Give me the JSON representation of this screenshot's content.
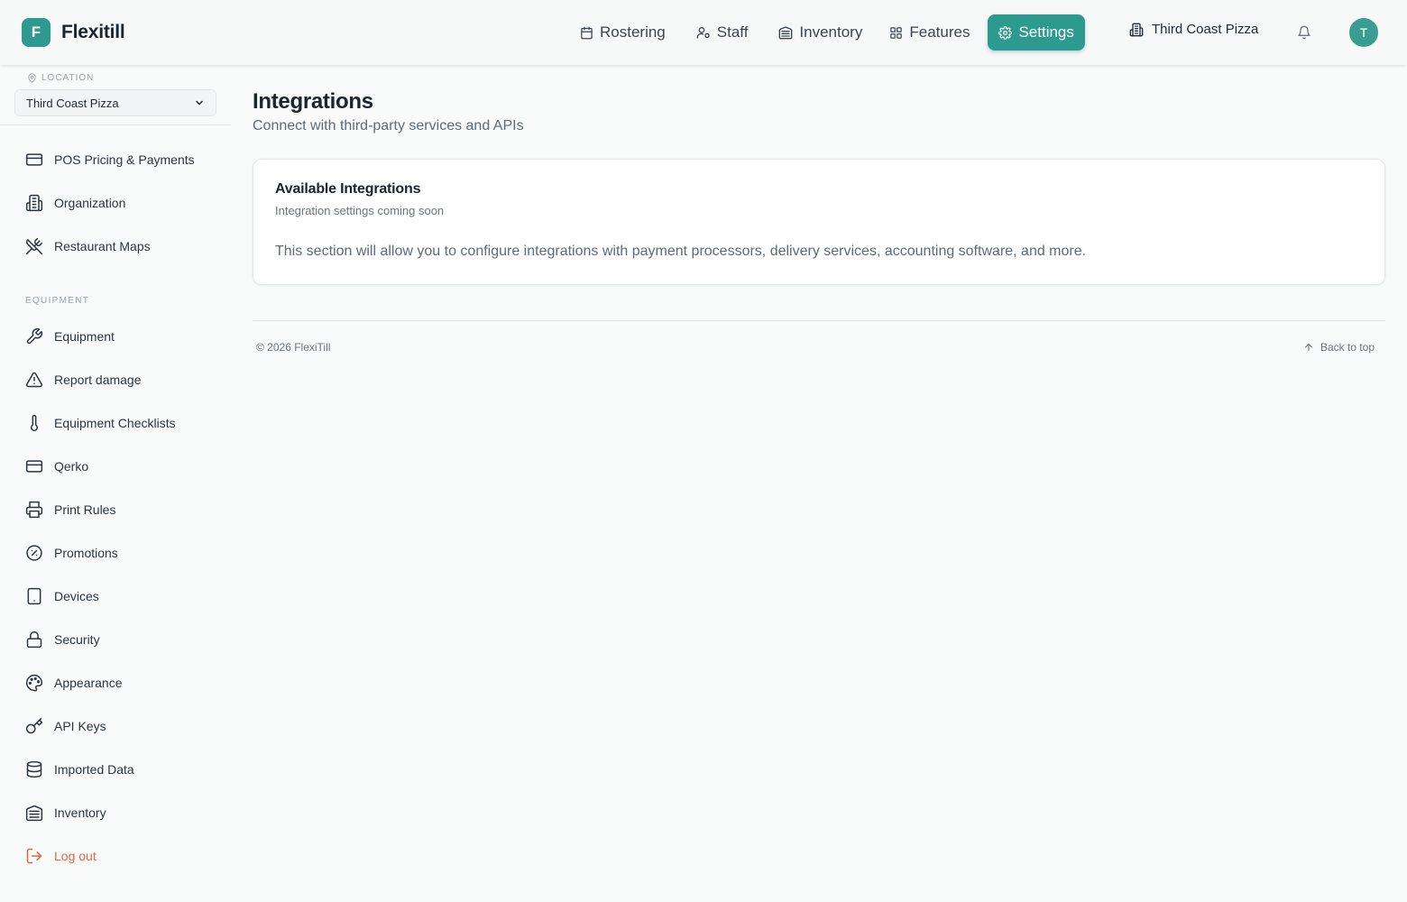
{
  "app": {
    "name": "Flexitill",
    "logo_letter": "F"
  },
  "nav": {
    "items": [
      {
        "label": "Rostering",
        "icon": "calendar-icon"
      },
      {
        "label": "Staff",
        "icon": "users-icon"
      },
      {
        "label": "Inventory",
        "icon": "warehouse-icon"
      },
      {
        "label": "Features",
        "icon": "grid-icon"
      },
      {
        "label": "Settings",
        "icon": "gear-icon",
        "active": true
      }
    ],
    "venue": "Third Coast Pizza",
    "avatar_initial": "T"
  },
  "sidebar": {
    "location_label": "Location",
    "location_value": "Third Coast Pizza",
    "items_top": [
      {
        "label": "POS Pricing & Payments",
        "icon": "credit-card-icon"
      },
      {
        "label": "Organization",
        "icon": "building-icon"
      },
      {
        "label": "Restaurant Maps",
        "icon": "utensils-crossed-icon"
      }
    ],
    "section_label": "Equipment",
    "items_equipment": [
      {
        "label": "Equipment",
        "icon": "wrench-icon"
      },
      {
        "label": "Report damage",
        "icon": "warning-icon"
      },
      {
        "label": "Equipment Checklists",
        "icon": "thermometer-icon"
      },
      {
        "label": "Qerko",
        "icon": "credit-card-icon"
      },
      {
        "label": "Print Rules",
        "icon": "printer-icon"
      },
      {
        "label": "Promotions",
        "icon": "badge-percent-icon"
      },
      {
        "label": "Devices",
        "icon": "tablet-icon"
      },
      {
        "label": "Security",
        "icon": "lock-icon"
      },
      {
        "label": "Appearance",
        "icon": "palette-icon"
      },
      {
        "label": "API Keys",
        "icon": "key-icon"
      },
      {
        "label": "Imported Data",
        "icon": "database-icon"
      },
      {
        "label": "Inventory",
        "icon": "warehouse-icon"
      }
    ],
    "logout_label": "Log out"
  },
  "main": {
    "title": "Integrations",
    "subtitle": "Connect with third-party services and APIs",
    "card": {
      "title": "Available Integrations",
      "subtitle": "Integration settings coming soon",
      "body": "This section will allow you to configure integrations with payment processors, delivery services, accounting software, and more."
    }
  },
  "footer": {
    "copyright": "© 2026 FlexiTill",
    "back_to_top": "Back to top"
  },
  "colors": {
    "accent": "#2c9a8e",
    "logout": "#e0683f"
  }
}
